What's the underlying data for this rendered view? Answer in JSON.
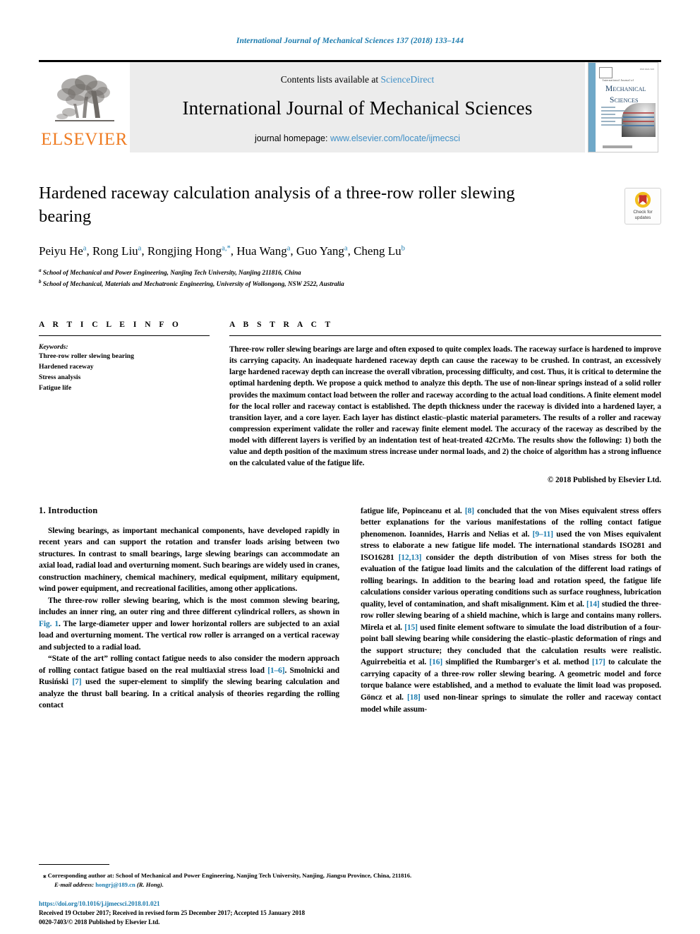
{
  "running_head": "International Journal of Mechanical Sciences 137 (2018) 133–144",
  "masthead": {
    "publisher_name": "ELSEVIER",
    "contents_prefix": "Contents lists available at ",
    "contents_link": "ScienceDirect",
    "journal_name": "International Journal of Mechanical Sciences",
    "homepage_prefix": "journal homepage: ",
    "homepage_link": "www.elsevier.com/locate/ijmecsci",
    "cover": {
      "eyebrow": "International Journal of",
      "line1": "M",
      "line1_rest": "ECHANICAL",
      "line2": "S",
      "line2_rest": "CIENCES",
      "issn": "ISSN 0020-7403",
      "footer": "ScienceDirect"
    }
  },
  "article": {
    "title": "Hardened raceway calculation analysis of a three-row roller slewing bearing",
    "authors": [
      {
        "name": "Peiyu He",
        "marks": "a"
      },
      {
        "name": "Rong Liu",
        "marks": "a"
      },
      {
        "name": "Rongjing Hong",
        "marks": "a,*"
      },
      {
        "name": "Hua Wang",
        "marks": "a"
      },
      {
        "name": "Guo Yang",
        "marks": "a"
      },
      {
        "name": "Cheng Lu",
        "marks": "b"
      }
    ],
    "affiliations": [
      {
        "mark": "a",
        "text": "School of Mechanical and Power Engineering, Nanjing Tech University, Nanjing 211816, China"
      },
      {
        "mark": "b",
        "text": "School of Mechanical, Materials and Mechatronic Engineering, University of Wollongong, NSW 2522, Australia"
      }
    ],
    "crossmark_label": "Check for\nupdates"
  },
  "article_info": {
    "heading": "A R T I C L E   I N F O",
    "keywords_label": "Keywords:",
    "keywords": [
      "Three-row roller slewing bearing",
      "Hardened raceway",
      "Stress analysis",
      "Fatigue life"
    ]
  },
  "abstract": {
    "heading": "A B S T R A C T",
    "text": "Three-row roller slewing bearings are large and often exposed to quite complex loads. The raceway surface is hardened to improve its carrying capacity. An inadequate hardened raceway depth can cause the raceway to be crushed. In contrast, an excessively large hardened raceway depth can increase the overall vibration, processing difficulty, and cost. Thus, it is critical to determine the optimal hardening depth. We propose a quick method to analyze this depth. The use of non-linear springs instead of a solid roller provides the maximum contact load between the roller and raceway according to the actual load conditions. A finite element model for the local roller and raceway contact is established. The depth thickness under the raceway is divided into a hardened layer, a transition layer, and a core layer. Each layer has distinct elastic–plastic material parameters. The results of a roller and raceway compression experiment validate the roller and raceway finite element model. The accuracy of the raceway as described by the model with different layers is verified by an indentation test of heat-treated 42CrMo. The results show the following: 1) both the value and depth position of the maximum stress increase under normal loads, and 2) the choice of algorithm has a strong influence on the calculated value of the fatigue life.",
    "copyright": "© 2018 Published by Elsevier Ltd."
  },
  "body": {
    "section_heading": "1. Introduction",
    "left_paragraphs": [
      "Slewing bearings, as important mechanical components, have developed rapidly in recent years and can support the rotation and transfer loads arising between two structures. In contrast to small bearings, large slewing bearings can accommodate an axial load, radial load and overturning moment. Such bearings are widely used in cranes, construction machinery, chemical machinery, medical equipment, military equipment, wind power equipment, and recreational facilities, among other applications.",
      "The three-row roller slewing bearing, which is the most common slewing bearing, includes an inner ring, an outer ring and three different cylindrical rollers, as shown in Fig. 1. The large-diameter upper and lower horizontal rollers are subjected to an axial load and overturning moment. The vertical row roller is arranged on a vertical raceway and subjected to a radial load.",
      "“State of the art” rolling contact fatigue needs to also consider the modern approach of rolling contact fatigue based on the real multiaxial stress load [1–6]. Smolnicki and Rusiński [7] used the super-element to simplify the slewing bearing calculation and analyze the thrust ball bearing. In a critical analysis of theories regarding the rolling contact"
    ],
    "right_paragraphs": [
      "fatigue life, Popinceanu et al. [8] concluded that the von Mises equivalent stress offers better explanations for the various manifestations of the rolling contact fatigue phenomenon. Ioannides, Harris and Nelias et al. [9–11] used the von Mises equivalent stress to elaborate a new fatigue life model. The international standards ISO281 and ISO16281 [12,13] consider the depth distribution of von Mises stress for both the evaluation of the fatigue load limits and the calculation of the different load ratings of rolling bearings. In addition to the bearing load and rotation speed, the fatigue life calculations consider various operating conditions such as surface roughness, lubrication quality, level of contamination, and shaft misalignment. Kim et al. [14] studied the three-row roller slewing bearing of a shield machine, which is large and contains many rollers. Mirela et al. [15] used finite element software to simulate the load distribution of a four-point ball slewing bearing while considering the elastic–plastic deformation of rings and the support structure; they concluded that the calculation results were realistic. Aguirrebeitia et al. [16] simplified the Rumbarger's et al. method [17] to calculate the carrying capacity of a three-row roller slewing bearing. A geometric model and force torque balance were established, and a method to evaluate the limit load was proposed. Göncz et al. [18] used non-linear springs to simulate the roller and raceway contact model while assum-"
    ],
    "inline_refs_left": [
      "Fig. 1",
      "[1–6]",
      "[7]"
    ],
    "inline_refs_right": [
      "[8]",
      "[9–11]",
      "[12,13]",
      "[14]",
      "[15]",
      "[16]",
      "[17]",
      "[18]"
    ]
  },
  "footnotes": {
    "corresponding_marker": "⁎",
    "corresponding": "Corresponding author at: School of Mechanical and Power Engineering, Nanjing Tech University, Nanjing, Jiangsu Province, China, 211816.",
    "email_label": "E-mail address:",
    "email": "hongrj@189.cn",
    "email_suffix": "(R. Hong)."
  },
  "colophon": {
    "doi": "https://doi.org/10.1016/j.ijmecsci.2018.01.021",
    "history": "Received 19 October 2017; Received in revised form 25 December 2017; Accepted 15 January 2018",
    "issn_copyright": "0020-7403/© 2018 Published by Elsevier Ltd."
  },
  "colors": {
    "link": "#3f8fc6",
    "ref": "#1a7aad",
    "elsevier_orange": "#ef7c23",
    "masthead_bg": "#ececec"
  }
}
